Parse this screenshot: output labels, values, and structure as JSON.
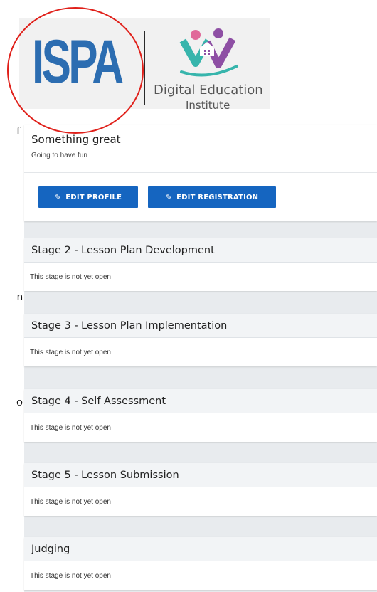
{
  "logo": {
    "isp_text": "ISPA",
    "dei_line1": "Digital Education",
    "dei_line2": "Institute",
    "colors": {
      "isp_blue": "#2c6db1",
      "circle": "#e0201a",
      "dei_purple": "#8e4fa4",
      "dei_teal": "#37b5ac"
    }
  },
  "left_strip": [
    "f",
    "n",
    "o"
  ],
  "profile": {
    "title": "Something great",
    "subtitle": "Going to have fun",
    "edit_profile_label": "EDIT PROFILE",
    "edit_registration_label": "EDIT REGISTRATION",
    "edit_icon": "edit-icon",
    "button_color": "#1565c0"
  },
  "stages": [
    {
      "title": "Stage 2 - Lesson Plan Development",
      "status": "This stage is not yet open"
    },
    {
      "title": "Stage 3 - Lesson Plan Implementation",
      "status": "This stage is not yet open"
    },
    {
      "title": "Stage 4 - Self Assessment",
      "status": "This stage is not yet open"
    },
    {
      "title": "Stage 5 - Lesson Submission",
      "status": "This stage is not yet open"
    },
    {
      "title": "Judging",
      "status": "This stage is not yet open"
    }
  ]
}
